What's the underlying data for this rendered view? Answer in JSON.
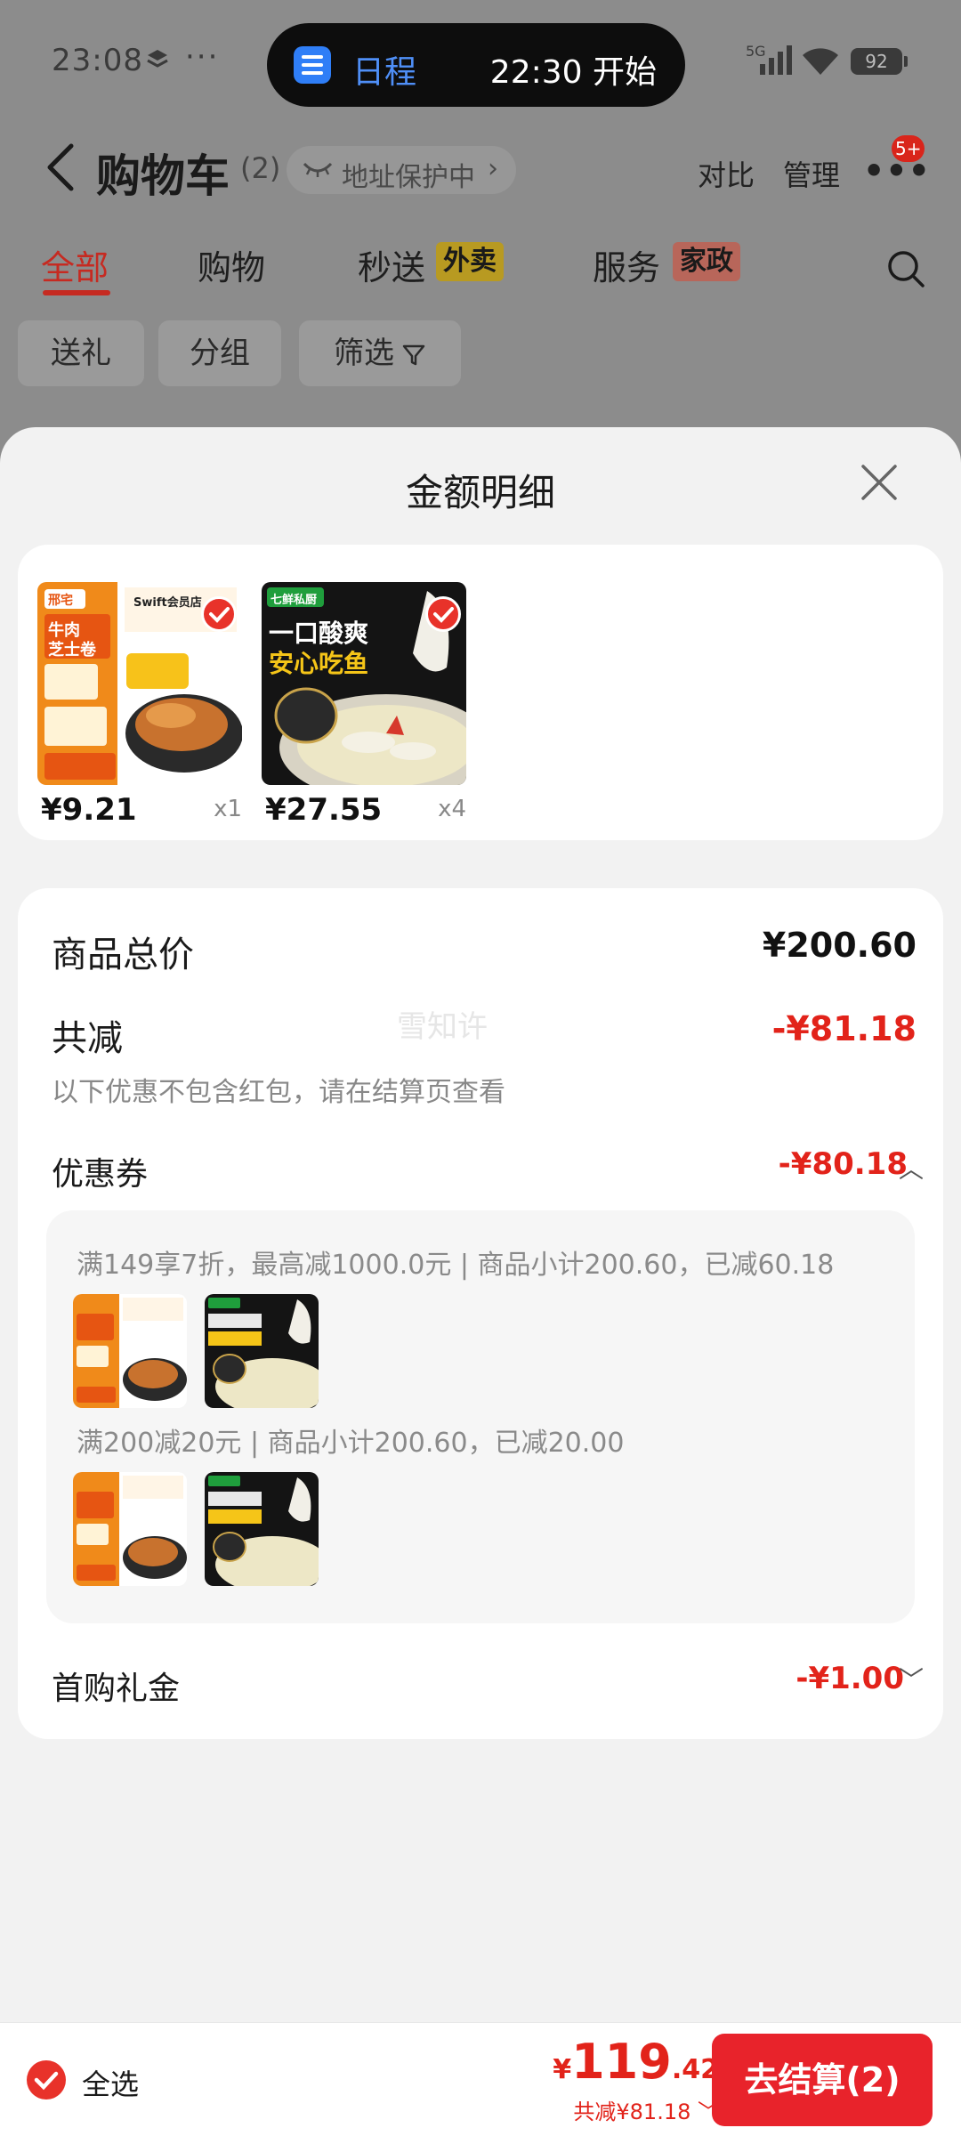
{
  "status_bar": {
    "time": "23:08",
    "dots": "···",
    "island_label": "日程",
    "island_time": "22:30 开始",
    "network": "5G",
    "battery": "92"
  },
  "header": {
    "title": "购物车",
    "count": "(2)",
    "address_pill": "地址保护中",
    "address_chevron": "›",
    "compare": "对比",
    "manage": "管理",
    "more": "•••",
    "badge": "5+"
  },
  "tabs": [
    {
      "label": "全部"
    },
    {
      "label": "购物"
    },
    {
      "label": "秒送",
      "tag": "外卖"
    },
    {
      "label": "服务",
      "tag": "家政"
    }
  ],
  "filters": [
    "送礼",
    "分组",
    "筛选"
  ],
  "sheet": {
    "title": "金额明细",
    "products": [
      {
        "price": "¥9.21",
        "qty": "x1",
        "image": "beef-cheese-roll",
        "brand": "邢宅",
        "name_line1": "牛肉",
        "name_line2": "芝士卷",
        "promo": "Swift会员店"
      },
      {
        "price": "¥27.55",
        "qty": "x4",
        "image": "sour-fish",
        "brand": "七鲜私厨",
        "name_line1": "一口酸爽",
        "name_line2": "安心吃鱼"
      }
    ],
    "summary": {
      "total_label": "商品总价",
      "total_value": "¥200.60",
      "discount_label": "共减",
      "discount_value": "-¥81.18",
      "note": "以下优惠不包含红包，请在结算页查看",
      "watermark": "雪知许",
      "coupon_label": "优惠券",
      "coupon_value": "-¥80.18",
      "coupon_chevron": "︿",
      "coupon_rules": [
        "满149享7折，最高减1000.0元 | 商品小计200.60，已减60.18",
        "满200减20元 | 商品小计200.60，已减20.00"
      ],
      "gift_label": "首购礼金",
      "gift_value": "-¥1.00",
      "gift_chevron": "﹀"
    }
  },
  "bottom_bar": {
    "select_all": "全选",
    "currency": "¥",
    "total_int": "119",
    "total_dec": ".42",
    "saved": "共减¥81.18 ﹀",
    "checkout": "去结算(2)"
  },
  "colors": {
    "accent_red": "#e2231a",
    "button_red": "#e8232b",
    "island_blue": "#2f7ef7"
  }
}
